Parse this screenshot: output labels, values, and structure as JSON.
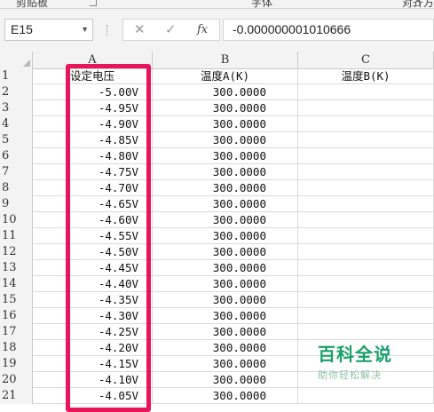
{
  "ribbon": {
    "groups": [
      "剪贴板",
      "字体",
      "对齐方"
    ]
  },
  "formula_bar": {
    "name_box": "E15",
    "cancel_icon": "close-icon",
    "enter_icon": "check-icon",
    "fx_label": "fx",
    "formula_value": "-0.000000001010666"
  },
  "columns": [
    {
      "letter": "A"
    },
    {
      "letter": "B"
    },
    {
      "letter": "C"
    }
  ],
  "rows": [
    {
      "num": "1",
      "a": "设定电压",
      "b": "温度A(K)",
      "c": "温度B(K)"
    },
    {
      "num": "2",
      "a": "-5.00V",
      "b": "300.0000",
      "c": ""
    },
    {
      "num": "3",
      "a": "-4.95V",
      "b": "300.0000",
      "c": ""
    },
    {
      "num": "4",
      "a": "-4.90V",
      "b": "300.0000",
      "c": ""
    },
    {
      "num": "5",
      "a": "-4.85V",
      "b": "300.0000",
      "c": ""
    },
    {
      "num": "6",
      "a": "-4.80V",
      "b": "300.0000",
      "c": ""
    },
    {
      "num": "7",
      "a": "-4.75V",
      "b": "300.0000",
      "c": ""
    },
    {
      "num": "8",
      "a": "-4.70V",
      "b": "300.0000",
      "c": ""
    },
    {
      "num": "9",
      "a": "-4.65V",
      "b": "300.0000",
      "c": ""
    },
    {
      "num": "10",
      "a": "-4.60V",
      "b": "300.0000",
      "c": ""
    },
    {
      "num": "11",
      "a": "-4.55V",
      "b": "300.0000",
      "c": ""
    },
    {
      "num": "12",
      "a": "-4.50V",
      "b": "300.0000",
      "c": ""
    },
    {
      "num": "13",
      "a": "-4.45V",
      "b": "300.0000",
      "c": ""
    },
    {
      "num": "14",
      "a": "-4.40V",
      "b": "300.0000",
      "c": ""
    },
    {
      "num": "15",
      "a": "-4.35V",
      "b": "300.0000",
      "c": ""
    },
    {
      "num": "16",
      "a": "-4.30V",
      "b": "300.0000",
      "c": ""
    },
    {
      "num": "17",
      "a": "-4.25V",
      "b": "300.0000",
      "c": ""
    },
    {
      "num": "18",
      "a": "-4.20V",
      "b": "300.0000",
      "c": ""
    },
    {
      "num": "19",
      "a": "-4.15V",
      "b": "300.0000",
      "c": ""
    },
    {
      "num": "20",
      "a": "-4.10V",
      "b": "300.0000",
      "c": ""
    },
    {
      "num": "21",
      "a": "-4.05V",
      "b": "300.0000",
      "c": ""
    }
  ],
  "highlight": {
    "color": "#e8155b"
  },
  "watermark": {
    "title": "百科全说",
    "subtitle": "助你轻松解决"
  }
}
